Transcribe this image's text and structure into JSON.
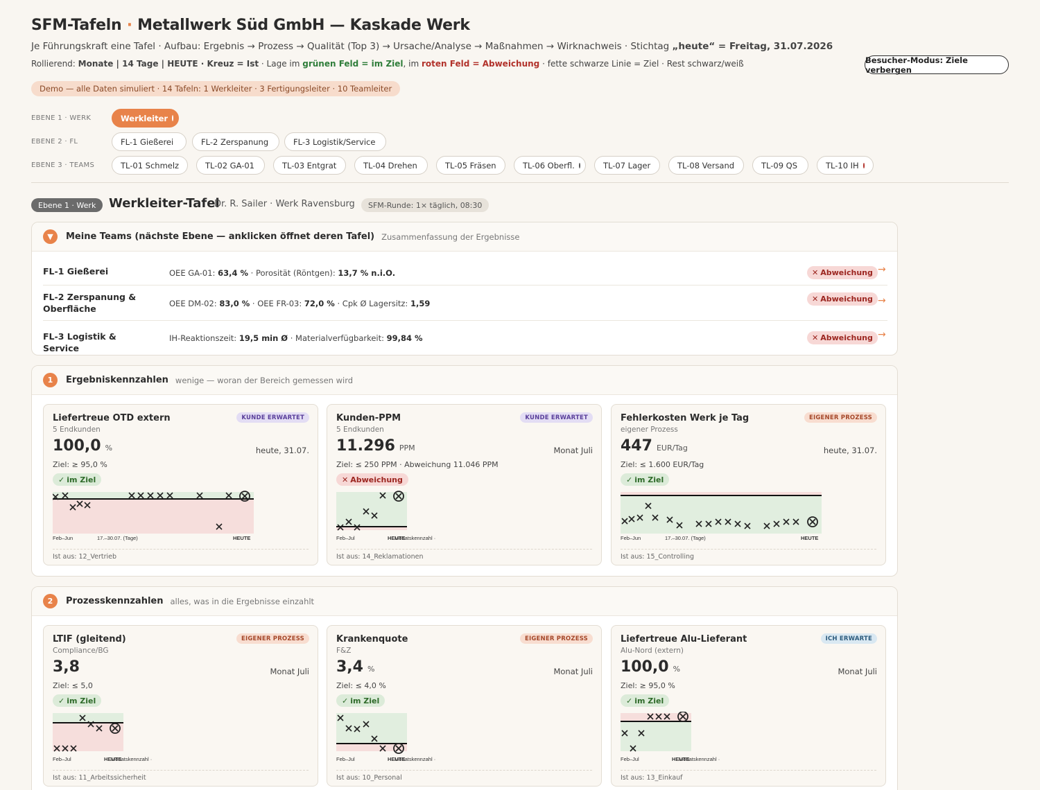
{
  "header": {
    "title_a": "SFM-Tafeln",
    "title_dot": "·",
    "title_b": "Metallwerk Süd GmbH — Kaskade Werk",
    "subtitle_a": "Je Führungskraft eine Tafel · Aufbau: Ergebnis → Prozess → Qualität (Top 3) → Ursache/Analyse → Maßnahmen → Wirknachweis · Stichtag ",
    "subtitle_b": "„heute“ = Freitag, 31.07.2026",
    "legend_roll": "Rollierend: ",
    "legend_roll_b": "Monate | 14 Tage | HEUTE · Kreuz = Ist",
    "legend_mid": " · Lage im ",
    "legend_green": "grünen Feld = im Ziel",
    "legend_mid2": ", im ",
    "legend_red": "roten Feld = Abweichung",
    "legend_end": " · fette schwarze Linie = Ziel · Rest schwarz/weiß",
    "visitor_btn": "Besucher-Modus: Ziele verbergen",
    "demo": "Demo — alle Daten simuliert · 14 Tafeln: 1 Werkleiter · 3 Fertigungsleiter · 10 Teamleiter"
  },
  "levels": {
    "l1_label": "EBENE 1 · WERK",
    "l2_label": "EBENE 2 · FL",
    "l3_label": "EBENE 3 · TEAMS",
    "l1": [
      {
        "label": "Werkleiter",
        "status": "red"
      }
    ],
    "l2": [
      {
        "label": "FL-1 Gießerei",
        "status": "red"
      },
      {
        "label": "FL-2 Zerspanung",
        "status": "red"
      },
      {
        "label": "FL-3 Logistik/Service",
        "status": "red"
      }
    ],
    "l3": [
      {
        "label": "TL-01 Schmelz",
        "status": "red"
      },
      {
        "label": "TL-02 GA-01",
        "status": "red"
      },
      {
        "label": "TL-03 Entgrat",
        "status": "red"
      },
      {
        "label": "TL-04 Drehen",
        "status": "red"
      },
      {
        "label": "TL-05 Fräsen",
        "status": "red"
      },
      {
        "label": "TL-06 Oberfl.",
        "status": "open"
      },
      {
        "label": "TL-07 Lager",
        "status": "green"
      },
      {
        "label": "TL-08 Versand",
        "status": "red"
      },
      {
        "label": "TL-09 QS",
        "status": "red"
      },
      {
        "label": "TL-10 IH",
        "status": "red"
      }
    ]
  },
  "board": {
    "tag": "Ebene 1 · Werk",
    "title": "Werkleiter-Tafel",
    "person": "Dr. R. Sailer · Werk Ravensburg",
    "sfm": "SFM-Runde: 1× täglich, 08:30"
  },
  "teams": {
    "title": "Meine Teams (nächste Ebene — anklicken öffnet deren Tafel)",
    "sub": "Zusammenfassung der Ergebnisse",
    "rows": [
      {
        "name": "FL-1 Gießerei",
        "m1": "OEE GA-01: ",
        "v1": "63,4 %",
        "m2": " · Porosität (Röntgen): ",
        "v2": "13,7 % n.i.O.",
        "m3": "",
        "v3": "",
        "status": "Abweichung"
      },
      {
        "name": "FL-2 Zerspanung & Oberfläche",
        "m1": "OEE DM-02: ",
        "v1": "83,0 %",
        "m2": " · OEE FR-03: ",
        "v2": "72,0 %",
        "m3": " · Cpk Ø Lagersitz: ",
        "v3": "1,59",
        "status": "Abweichung"
      },
      {
        "name": "FL-3 Logistik & Service",
        "m1": "IH-Reaktionszeit: ",
        "v1": "19,5 min Ø",
        "m2": " · Materialverfügbarkeit: ",
        "v2": "99,84 %",
        "m3": "",
        "v3": "",
        "status": "Abweichung"
      }
    ]
  },
  "results": {
    "num": "1",
    "title": "Ergebniskennzahlen",
    "sub": "wenige — woran der Bereich gemessen wird"
  },
  "process": {
    "num": "2",
    "title": "Prozesskennzahlen",
    "sub": "alles, was in die Ergebnisse einzahlt"
  },
  "axis": {
    "feb_jun": "Feb–Jun",
    "feb_jul": "Feb–Jul",
    "days": "17.–30.07. (Tage)",
    "heute": "HEUTE",
    "month_val": "Monatskennzahl ·"
  },
  "cards": [
    {
      "title": "Liefertreue OTD extern",
      "src": "5 Endkunden",
      "tag": "KUNDE ERWARTET",
      "tagtype": "kunde",
      "value": "100,0",
      "unit": "%",
      "when": "heute, 31.07.",
      "goal": "Ziel: ≥ 95,0 %",
      "status": "im Ziel",
      "ok": true,
      "foot": "Ist aus: 12_Vertrieb"
    },
    {
      "title": "Kunden-PPM",
      "src": "5 Endkunden",
      "tag": "KUNDE ERWARTET",
      "tagtype": "kunde",
      "value": "11.296",
      "unit": "PPM",
      "when": "Monat Juli",
      "goal": "Ziel: ≤ 250 PPM · Abweichung 11.046 PPM",
      "status": "Abweichung",
      "ok": false,
      "foot": "Ist aus: 14_Reklamationen"
    },
    {
      "title": "Fehlerkosten Werk je Tag",
      "src": "eigener Prozess",
      "tag": "EIGENER PROZESS",
      "tagtype": "eigen",
      "value": "447",
      "unit": "EUR/Tag",
      "when": "heute, 31.07.",
      "goal": "Ziel: ≤ 1.600 EUR/Tag",
      "status": "im Ziel",
      "ok": true,
      "foot": "Ist aus: 15_Controlling"
    },
    {
      "title": "LTIF (gleitend)",
      "src": "Compliance/BG",
      "tag": "EIGENER PROZESS",
      "tagtype": "eigen",
      "value": "3,8",
      "unit": "",
      "when": "Monat Juli",
      "goal": "Ziel: ≤ 5,0",
      "status": "im Ziel",
      "ok": true,
      "foot": "Ist aus: 11_Arbeitssicherheit"
    },
    {
      "title": "Krankenquote",
      "src": "F&Z",
      "tag": "EIGENER PROZESS",
      "tagtype": "eigen",
      "value": "3,4",
      "unit": "%",
      "when": "Monat Juli",
      "goal": "Ziel: ≤ 4,0 %",
      "status": "im Ziel",
      "ok": true,
      "foot": "Ist aus: 10_Personal"
    },
    {
      "title": "Liefertreue Alu-Lieferant",
      "src": "Alu-Nord (extern)",
      "tag": "ICH ERWARTE",
      "tagtype": "ich",
      "value": "100,0",
      "unit": "%",
      "when": "Monat Juli",
      "goal": "Ziel: ≥ 95,0 %",
      "status": "im Ziel",
      "ok": true,
      "foot": "Ist aus: 13_Einkauf"
    }
  ],
  "colors": {
    "accent": "#e8834a",
    "red": "#b2322b",
    "green": "#2f8a3a"
  }
}
